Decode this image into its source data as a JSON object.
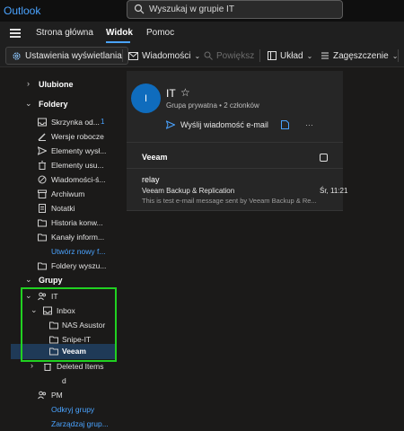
{
  "app": {
    "title": "Outlook"
  },
  "search": {
    "placeholder": "Wyszukaj w grupie IT"
  },
  "nav": {
    "tabs": [
      {
        "label": "Strona główna"
      },
      {
        "label": "Widok"
      },
      {
        "label": "Pomoc"
      }
    ]
  },
  "toolbar": {
    "view_settings": "Ustawienia wyświetlania",
    "messages": "Wiadomości",
    "zoom": "Powiększ",
    "layout": "Układ",
    "density": "Zagęszczenie"
  },
  "sidebar": {
    "favorites": "Ulubione",
    "folders": "Foldery",
    "folder_items": [
      {
        "label": "Skrzynka od...",
        "count": "1"
      },
      {
        "label": "Wersje robocze"
      },
      {
        "label": "Elementy wysł..."
      },
      {
        "label": "Elementy usu..."
      },
      {
        "label": "Wiadomości-ś..."
      },
      {
        "label": "Archiwum"
      },
      {
        "label": "Notatki"
      },
      {
        "label": "Historia konw..."
      },
      {
        "label": "Kanały inform..."
      }
    ],
    "create_folder": "Utwórz nowy f...",
    "search_folders": "Foldery wyszu...",
    "groups": "Grupy",
    "group_it": "IT",
    "inbox": "Inbox",
    "sub_items": [
      {
        "label": "NAS Asustor"
      },
      {
        "label": "Snipe-IT"
      },
      {
        "label": "Veeam"
      }
    ],
    "deleted_items": "Deleted Items",
    "d_item": "d",
    "group_pm": "PM",
    "discover_groups": "Odkryj grupy",
    "manage_groups": "Zarządzaj grup..."
  },
  "group_card": {
    "avatar": "I",
    "name": "IT",
    "privacy": "Grupa prywatna",
    "members": "2 członków",
    "send_email": "Wyślij wiadomość e-mail"
  },
  "folder_header": "Veeam",
  "message": {
    "sender": "relay",
    "subject": "Veeam Backup & Replication",
    "date": "Śr, 11:21",
    "preview": "This is test e-mail message sent by Veeam Backup & Re..."
  },
  "colors": {
    "accent": "#4aa3ff",
    "selected_bg": "#1f3a57",
    "highlight_box": "#21d121"
  }
}
